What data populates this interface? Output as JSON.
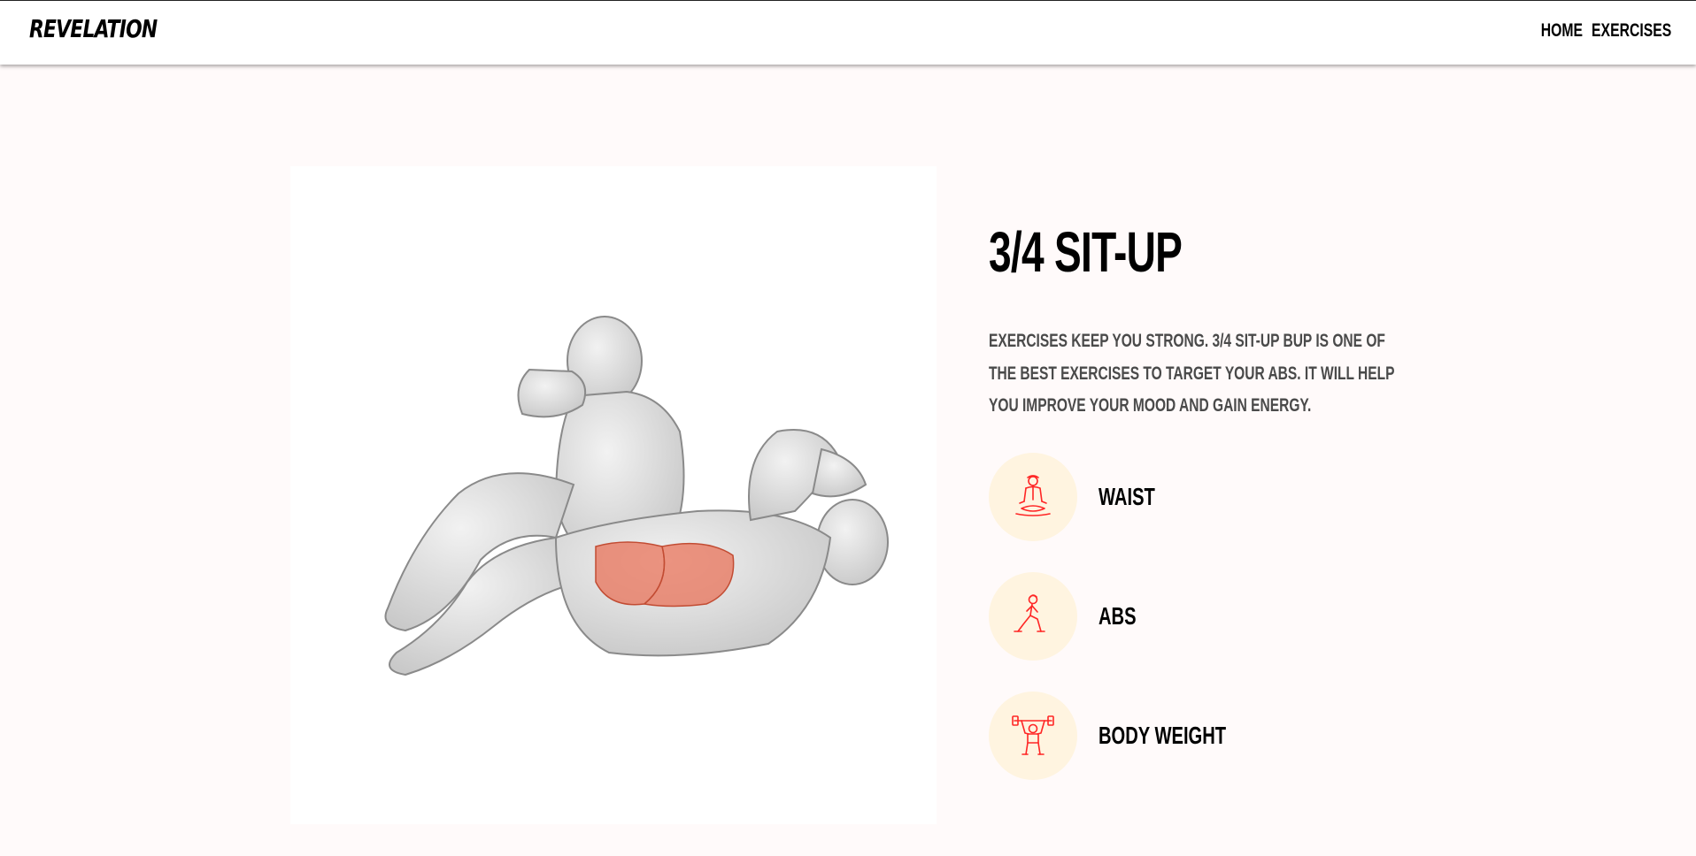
{
  "nav": {
    "logo": "REVELATION",
    "links": [
      "HOME",
      "EXERCISES"
    ]
  },
  "exercise": {
    "name": "3/4 SIT-UP",
    "description": "Exercises keep you strong. 3/4 sit-up bup is one of the best exercises to target your abs. It will help you improve your mood and gain energy.",
    "image_alt": "3/4 sit-up illustration"
  },
  "tags": [
    {
      "label": "WAIST",
      "icon": "meditation-icon"
    },
    {
      "label": "ABS",
      "icon": "lunge-icon"
    },
    {
      "label": "BODY WEIGHT",
      "icon": "weightlifter-icon"
    }
  ],
  "colors": {
    "page_bg": "#fffafa",
    "icon_circle": "#fff4e0",
    "icon_stroke": "#ff2625",
    "muscle_highlight": "#e8735a"
  }
}
